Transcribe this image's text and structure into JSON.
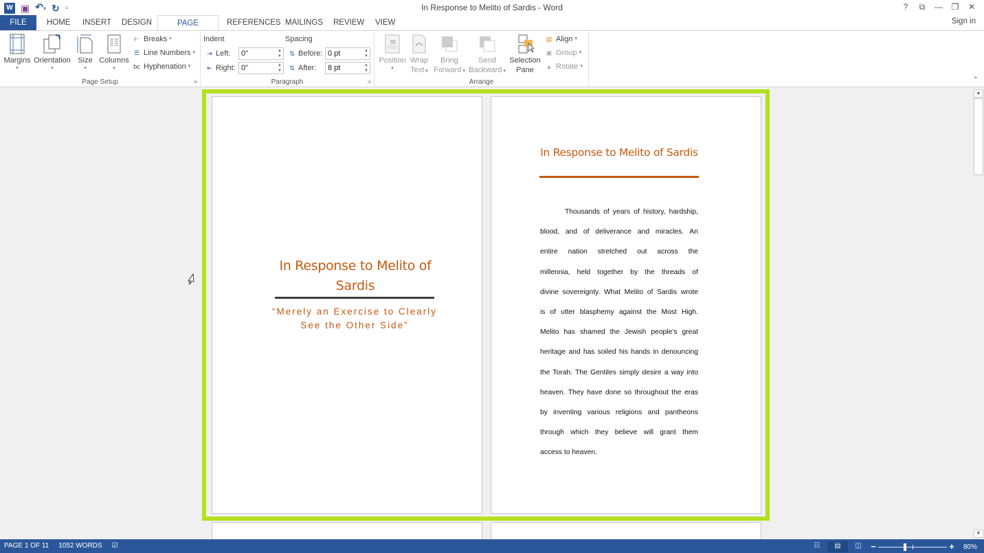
{
  "window": {
    "title": "In Response to Melito of Sardis - Word",
    "controls": {
      "help": "?",
      "ribbon_display": "⧉",
      "minimize": "—",
      "restore": "❐",
      "close": "✕"
    },
    "sign_in": "Sign in"
  },
  "qat": {
    "app_icon": "W",
    "save_icon": "💾",
    "undo_icon": "↶",
    "redo_icon": "↻",
    "customize_icon": "▾"
  },
  "tabs": [
    {
      "label": "FILE"
    },
    {
      "label": "HOME"
    },
    {
      "label": "INSERT"
    },
    {
      "label": "DESIGN"
    },
    {
      "label": "PAGE LAYOUT",
      "active": true
    },
    {
      "label": "REFERENCES"
    },
    {
      "label": "MAILINGS"
    },
    {
      "label": "REVIEW"
    },
    {
      "label": "VIEW"
    }
  ],
  "ribbon": {
    "page_setup": {
      "label": "Page Setup",
      "margins": "Margins",
      "orientation": "Orientation",
      "size": "Size",
      "columns": "Columns",
      "breaks": "Breaks",
      "line_numbers": "Line Numbers",
      "hyphenation": "Hyphenation"
    },
    "paragraph": {
      "label": "Paragraph",
      "indent_label": "Indent",
      "spacing_label": "Spacing",
      "left_label": "Left:",
      "right_label": "Right:",
      "before_label": "Before:",
      "after_label": "After:",
      "left_value": "0\"",
      "right_value": "0\"",
      "before_value": "0 pt",
      "after_value": "8 pt"
    },
    "arrange": {
      "label": "Arrange",
      "position": "Position",
      "wrap_text_1": "Wrap",
      "wrap_text_2": "Text",
      "bring_forward_1": "Bring",
      "bring_forward_2": "Forward",
      "send_backward_1": "Send",
      "send_backward_2": "Backward",
      "selection_pane_1": "Selection",
      "selection_pane_2": "Pane",
      "align": "Align",
      "group": "Group",
      "rotate": "Rotate"
    }
  },
  "document": {
    "cover": {
      "title": "In Response to Melito of Sardis",
      "subtitle": "“Merely an Exercise to Clearly See the Other Side”"
    },
    "page2": {
      "title": "In Response to Melito of Sardis",
      "lines": [
        "Thousands of years of history, hardship,",
        "blood, and of deliverance and miracles. An",
        "entire nation stretched out across the",
        "millennia, held together by the threads of",
        "divine sovereignty. What Melito of Sardis wrote",
        "is of utter blasphemy against the Most High.",
        "Melito has shamed the Jewish people’s great",
        "heritage and has soiled his hands in denouncing",
        "the Torah. The Gentiles simply desire a way into",
        "heaven. They have done so throughout the eras",
        "by inventing various religions and pantheons",
        "through which they believe will grant them",
        "access to heaven."
      ]
    },
    "selection_color": "#b5e01e",
    "accent_color": "#c55a11"
  },
  "status": {
    "page": "PAGE 1 OF 11",
    "words": "1052 WORDS",
    "zoom_percent": "80%",
    "zoom_level": 80
  }
}
